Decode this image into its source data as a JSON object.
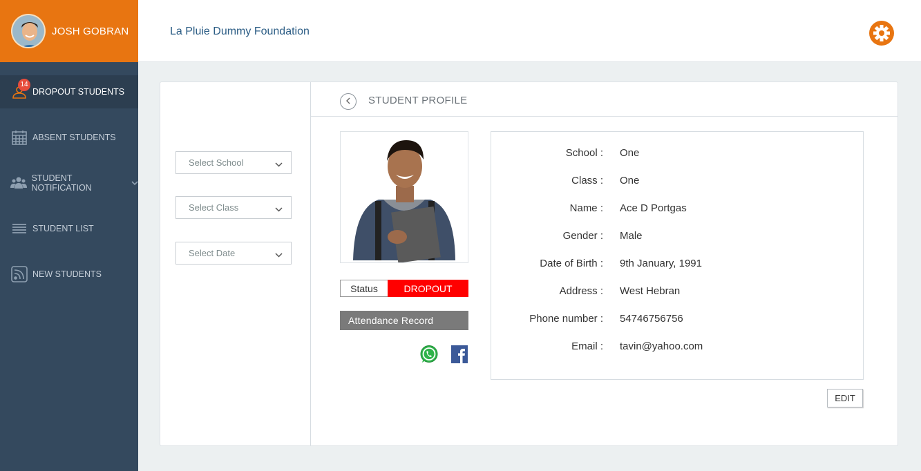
{
  "user": {
    "name": "JOSH GOBRAN"
  },
  "header": {
    "org_name": "La Pluie Dummy Foundation"
  },
  "sidebar": {
    "items": [
      {
        "label": "DROPOUT STUDENTS",
        "icon": "user-icon",
        "badge": "14",
        "active": true
      },
      {
        "label": "ABSENT STUDENTS",
        "icon": "calendar-icon"
      },
      {
        "label": "STUDENT NOTIFICATION",
        "icon": "users-icon",
        "has_submenu": true
      },
      {
        "label": "STUDENT LIST",
        "icon": "list-icon"
      },
      {
        "label": "NEW STUDENTS",
        "icon": "rss-icon"
      }
    ]
  },
  "filters": {
    "school": "Select School",
    "class": "Select Class",
    "date": "Select Date"
  },
  "profile": {
    "title": "STUDENT PROFILE",
    "status_label": "Status",
    "status_value": "DROPOUT",
    "attendance_label": "Attendance Record",
    "fields": [
      {
        "label": "School :",
        "value": "One"
      },
      {
        "label": "Class :",
        "value": "One"
      },
      {
        "label": "Name :",
        "value": "Ace D Portgas"
      },
      {
        "label": "Gender :",
        "value": "Male"
      },
      {
        "label": "Date of Birth :",
        "value": "9th January, 1991"
      },
      {
        "label": "Address :",
        "value": "West Hebran"
      },
      {
        "label": "Phone number :",
        "value": "54746756756"
      },
      {
        "label": "Email :",
        "value": "tavin@yahoo.com"
      }
    ],
    "edit_label": "EDIT"
  },
  "colors": {
    "accent": "#e87511",
    "sidebar": "#34495e",
    "sidebar_active": "#2c3e50",
    "status": "#ff0000",
    "badge": "#e74c3c"
  }
}
